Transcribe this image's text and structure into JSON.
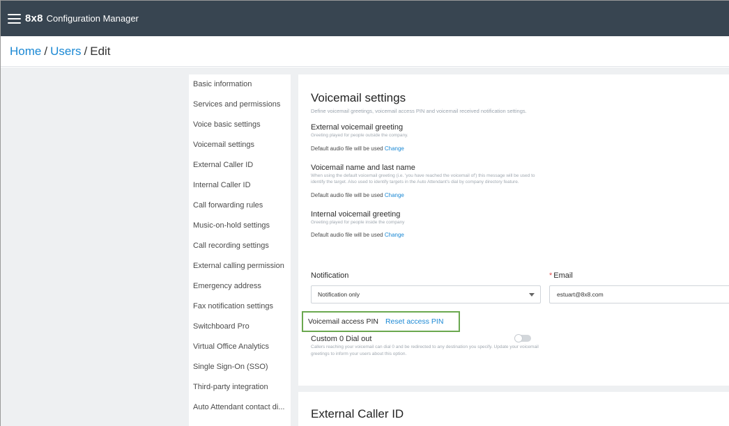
{
  "header": {
    "logo": "8x8",
    "app_title": "Configuration Manager"
  },
  "breadcrumb": {
    "home": "Home",
    "sep1": "/",
    "users": "Users",
    "sep2": "/",
    "current": "Edit"
  },
  "sidebar": {
    "items": [
      {
        "label": "Basic information"
      },
      {
        "label": "Services and permissions"
      },
      {
        "label": "Voice basic settings"
      },
      {
        "label": "Voicemail settings"
      },
      {
        "label": "External Caller ID"
      },
      {
        "label": "Internal Caller ID"
      },
      {
        "label": "Call forwarding rules"
      },
      {
        "label": "Music-on-hold settings"
      },
      {
        "label": "Call recording settings"
      },
      {
        "label": "External calling permission"
      },
      {
        "label": "Emergency address"
      },
      {
        "label": "Fax notification settings"
      },
      {
        "label": "Switchboard Pro"
      },
      {
        "label": "Virtual Office Analytics"
      },
      {
        "label": "Single Sign-On (SSO)"
      },
      {
        "label": "Third-party integration"
      },
      {
        "label": "Auto Attendant contact di..."
      }
    ]
  },
  "voicemail": {
    "title": "Voicemail settings",
    "subtitle": "Define voicemail greetings, voicemail access PIN and voicemail received notification settings.",
    "external_greeting": {
      "title": "External voicemail greeting",
      "desc": "Greeting played for people outside the company.",
      "audio_text": "Default audio file will be used",
      "change": "Change"
    },
    "name_greeting": {
      "title": "Voicemail name and last name",
      "desc": "When using the default voicemail greeting (i.e. 'you have reached the voicemail of') this message will be used to identify the target. Also used to identify targets in the Auto Attendant's dial by company directory feature.",
      "audio_text": "Default audio file will be used",
      "change": "Change"
    },
    "internal_greeting": {
      "title": "Internal voicemail greeting",
      "desc": "Greeting played for people inside the company",
      "audio_text": "Default audio file will be used",
      "change": "Change"
    },
    "notification": {
      "label": "Notification",
      "selected": "Notification only"
    },
    "email": {
      "required_mark": "*",
      "label": "Email",
      "value": "estuart@8x8.com"
    },
    "pin": {
      "label": "Voicemail access PIN",
      "reset": "Reset access PIN"
    },
    "dial_out": {
      "title": "Custom 0 Dial out",
      "desc": "Callers reaching your voicemail can dial 0 and be redirected to any destination you specify. Update your voicemail greetings to inform your users about this option.",
      "enabled": false
    }
  },
  "external_caller_id": {
    "title": "External Caller ID"
  },
  "colors": {
    "topbar": "#384551",
    "link": "#1a88d4",
    "highlight": "#6aa84f",
    "required": "#e24c4b"
  }
}
